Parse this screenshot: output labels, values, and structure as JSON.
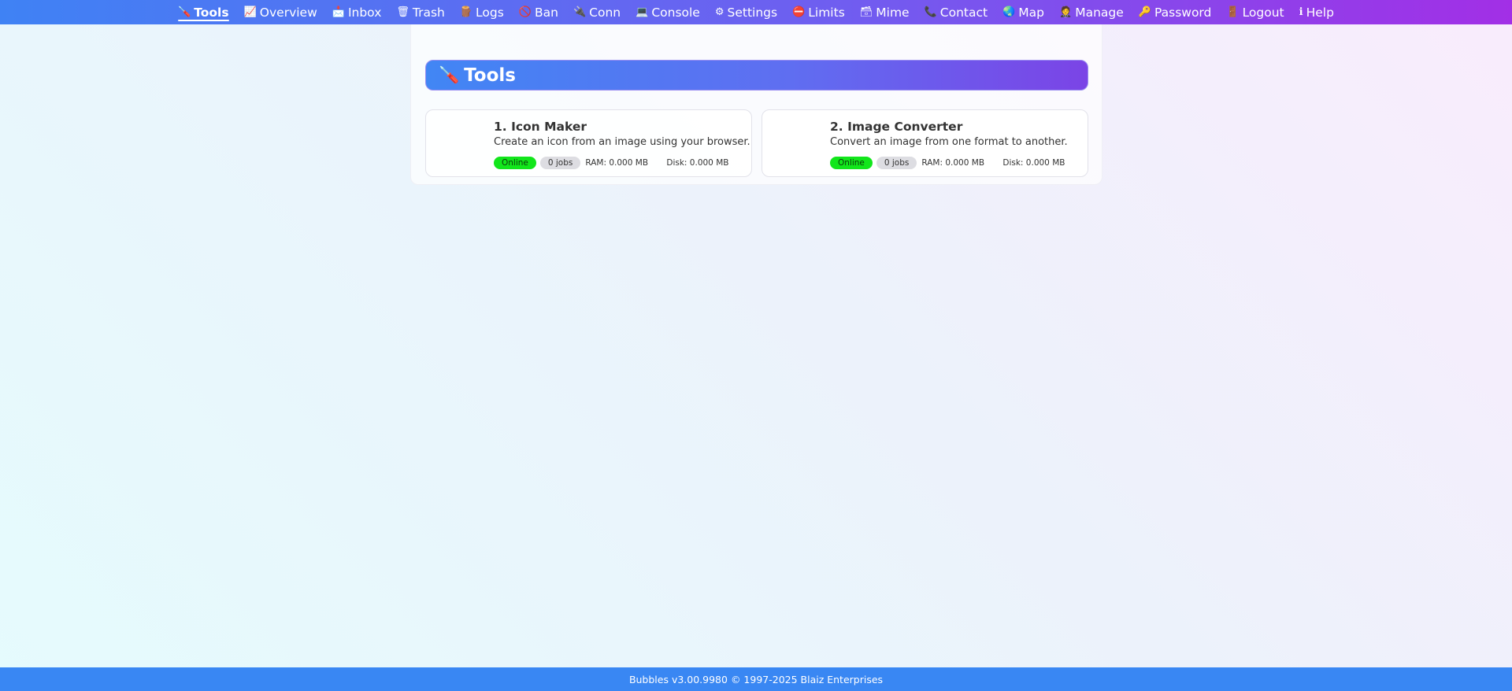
{
  "nav": {
    "items": [
      {
        "label": "Tools",
        "icon": "🪛",
        "active": true
      },
      {
        "label": "Overview",
        "icon": "📈"
      },
      {
        "label": "Inbox",
        "icon": "📩"
      },
      {
        "label": "Trash",
        "icon": "🗑"
      },
      {
        "label": "Logs",
        "icon": "🪵"
      },
      {
        "label": "Ban",
        "icon": "🚫"
      },
      {
        "label": "Conn",
        "icon": "🔌"
      },
      {
        "label": "Console",
        "icon": "💻"
      },
      {
        "label": "Settings",
        "icon": "⚙"
      },
      {
        "label": "Limits",
        "icon": "⛔"
      },
      {
        "label": "Mime",
        "icon": "🗃"
      },
      {
        "label": "Contact",
        "icon": "📞"
      },
      {
        "label": "Map",
        "icon": "🌏"
      },
      {
        "label": "Manage",
        "icon": "🤵"
      },
      {
        "label": "Password",
        "icon": "🔑"
      },
      {
        "label": "Logout",
        "icon": "🚪"
      },
      {
        "label": "Help",
        "icon": "ℹ"
      }
    ]
  },
  "section": {
    "icon": "🪛",
    "title": "Tools"
  },
  "tools": [
    {
      "title": "1. Icon Maker",
      "description": "Create an icon from an image using your browser.",
      "status": "Online",
      "jobs": "0 jobs",
      "ram": "RAM: 0.000 MB",
      "disk": "Disk: 0.000 MB"
    },
    {
      "title": "2. Image Converter",
      "description": "Convert an image from one format to another.",
      "status": "Online",
      "jobs": "0 jobs",
      "ram": "RAM: 0.000 MB",
      "disk": "Disk: 0.000 MB"
    }
  ],
  "footer": {
    "text": "Bubbles v3.00.9980 © 1997-2025 Blaiz Enterprises"
  },
  "colors": {
    "nav_start": "#3f82f4",
    "nav_end": "#a22fe6",
    "online": "#12e61b",
    "footer": "#3987f3"
  }
}
